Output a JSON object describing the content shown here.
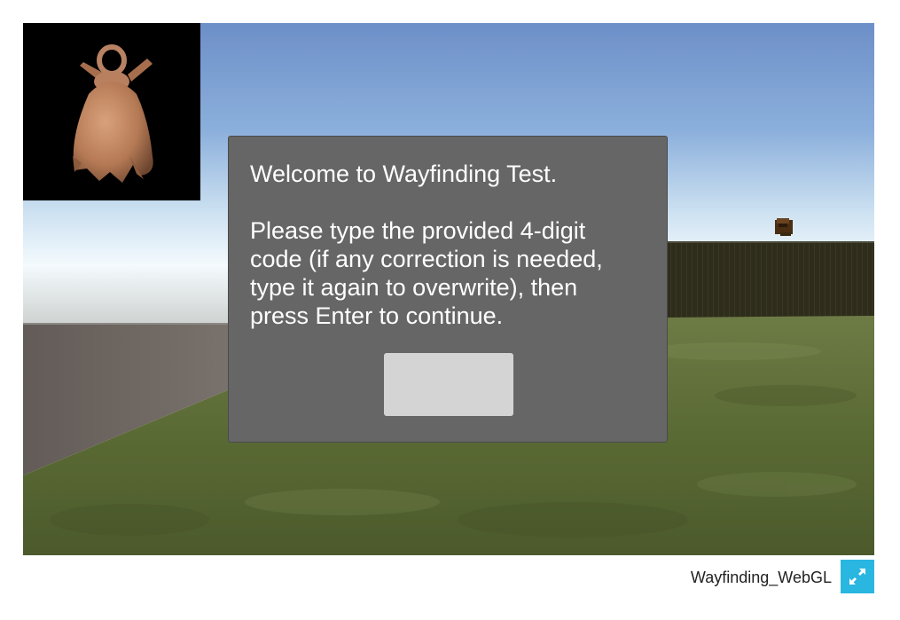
{
  "game": {
    "dialog": {
      "title": "Welcome to Wayfinding Test.",
      "body": "Please type the provided 4-digit code (if any correction is needed, type it again to overwrite), then press Enter to continue.",
      "code_input_value": "",
      "code_input_placeholder": ""
    },
    "target_preview": {
      "object": "clay-bell-icon"
    },
    "scene": {
      "sky_top_color": "#6f92c9",
      "sky_horizon_color": "#e8f3fb",
      "grass_color": "#5a6b34",
      "wall_color": "#2f2d1c",
      "ground_color": "#6b6460"
    }
  },
  "footer": {
    "title": "Wayfinding_WebGL",
    "fullscreen_icon": "fullscreen-icon",
    "accent_color": "#29b6e0"
  }
}
